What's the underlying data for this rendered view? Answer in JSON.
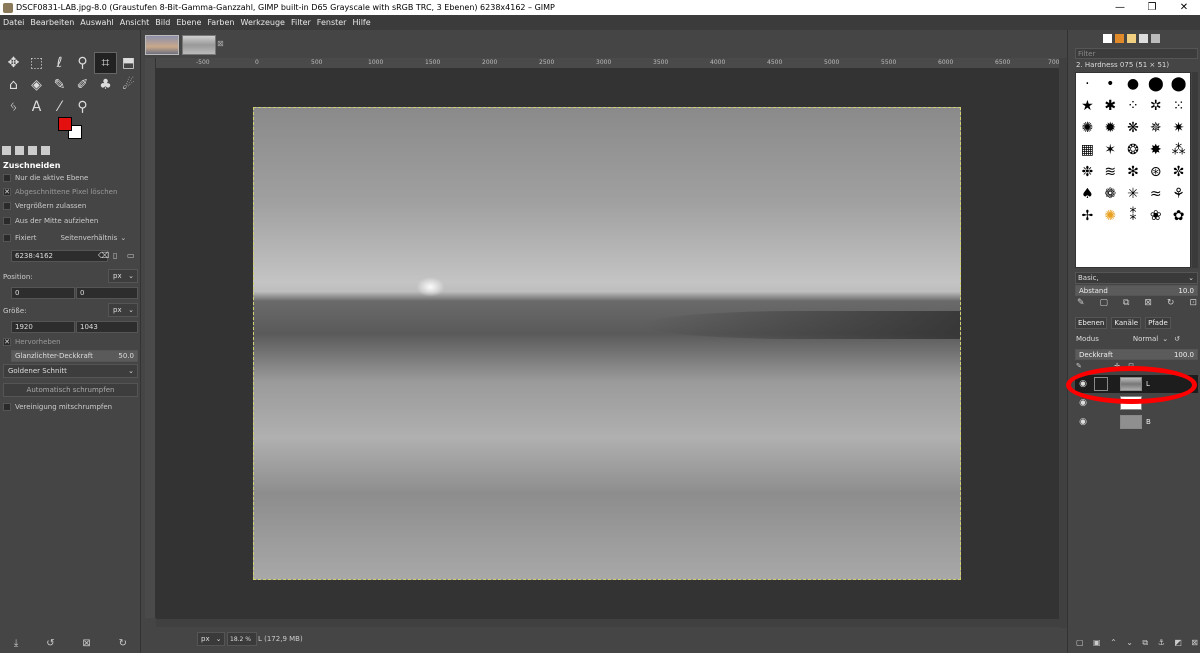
{
  "window": {
    "title": "DSCF0831-LAB.jpg-8.0 (Graustufen 8-Bit-Gamma-Ganzzahl, GIMP built-in D65 Grayscale with sRGB TRC, 3 Ebenen) 6238x4162 – GIMP",
    "minimize": "—",
    "maximize": "❐",
    "close": "✕"
  },
  "menu": [
    "Datei",
    "Bearbeiten",
    "Auswahl",
    "Ansicht",
    "Bild",
    "Ebene",
    "Farben",
    "Werkzeuge",
    "Filter",
    "Fenster",
    "Hilfe"
  ],
  "colors": {
    "foreground": "#e41010",
    "background": "#ffffff",
    "highlight": "#ff0000"
  },
  "tool_options": {
    "title": "Zuschneiden",
    "only_active_layer": "Nur die aktive Ebene",
    "delete_cropped": "Abgeschnittene Pixel löschen",
    "allow_grow": "Vergrößern zulassen",
    "from_center": "Aus der Mitte aufziehen",
    "fixed": "Fixiert",
    "fixed_mode": "Seitenverhältnis",
    "ratio_value": "6238:4162",
    "position_label": "Position:",
    "position_unit": "px",
    "pos_x": "0",
    "pos_y": "0",
    "size_label": "Größe:",
    "size_unit": "px",
    "size_w": "1920",
    "size_h": "1043",
    "highlight": "Hervorheben",
    "highlight_opacity_label": "Glanzlichter-Deckkraft",
    "highlight_opacity_value": "50.0",
    "guides": "Goldener Schnitt",
    "auto_shrink": "Automatisch schrumpfen",
    "shrink_merged": "Vereinigung mitschrumpfen"
  },
  "ruler": {
    "ticks": [
      "-500",
      "0",
      "500",
      "1000",
      "1500",
      "2000",
      "2500",
      "3000",
      "3500",
      "4000",
      "4500",
      "5000",
      "5500",
      "6000",
      "6500",
      "700"
    ]
  },
  "status": {
    "unit": "px",
    "zoom": "18.2 %",
    "info": "L (172,9 MB)"
  },
  "brushes": {
    "filter_placeholder": "Filter",
    "current": "2. Hardness 075 (51 × 51)",
    "tag": "Basic,",
    "spacing_label": "Abstand",
    "spacing_value": "10.0"
  },
  "layers": {
    "tabs": [
      "Ebenen",
      "Kanäle",
      "Pfade"
    ],
    "mode_label": "Modus",
    "mode_value": "Normal",
    "opacity_label": "Deckkraft",
    "opacity_value": "100.0",
    "items": [
      {
        "name": "L",
        "visible": true,
        "selected": true
      },
      {
        "name": "",
        "visible": true,
        "selected": false
      },
      {
        "name": "B",
        "visible": true,
        "selected": false
      }
    ]
  },
  "icons": {
    "move": "move-icon",
    "rect_select": "rect-select-icon",
    "lasso": "lasso-icon",
    "fuzzy": "fuzzy-select-icon",
    "crop": "crop-icon",
    "transform": "transform-icon",
    "warp": "warp-icon",
    "bucket": "bucket-fill-icon",
    "paintbrush": "paintbrush-icon",
    "eraser": "eraser-icon",
    "clone": "clone-icon",
    "smudge": "smudge-icon",
    "paths": "paths-icon",
    "text": "text-icon",
    "picker": "color-picker-icon",
    "zoom": "zoom-icon"
  }
}
